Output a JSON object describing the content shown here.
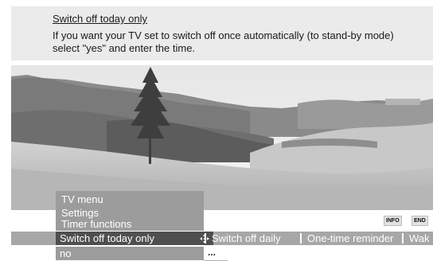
{
  "help": {
    "title": "Switch off today only",
    "text": "If you want your TV set to switch off once automatically (to stand-by mode) select \"yes\" and enter the time."
  },
  "menu": {
    "path": [
      "TV menu",
      "Settings",
      "Timer functions"
    ]
  },
  "keys": {
    "info": "INFO",
    "end": "END"
  },
  "function_bar": {
    "items": [
      "Switch off today only",
      "Switch off daily",
      "One-time reminder",
      "Wak"
    ],
    "selected_index": 0
  },
  "value": {
    "current": "no",
    "more": "..."
  },
  "icons": {
    "navigation": "four-way-arrows-icon"
  },
  "colors": {
    "help_bg": "#ebebeb",
    "menu_bg": "#9c9c9c",
    "bar_bg": "#a7a7a7",
    "selected_bg": "#4f4f4f"
  }
}
